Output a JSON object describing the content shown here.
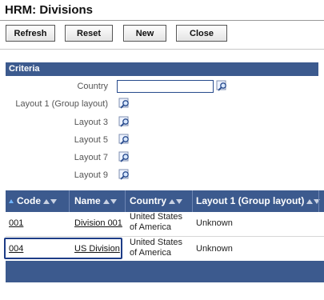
{
  "header": {
    "title": "HRM: Divisions"
  },
  "toolbar": {
    "refresh_label": "Refresh",
    "reset_label": "Reset",
    "new_label": "New",
    "close_label": "Close"
  },
  "criteria": {
    "title": "Criteria",
    "fields": [
      {
        "label": "Country",
        "value": "",
        "type": "text-input"
      },
      {
        "label": "Layout 1 (Group layout)",
        "type": "lookup"
      },
      {
        "label": "Layout 3",
        "type": "lookup"
      },
      {
        "label": "Layout 5",
        "type": "lookup"
      },
      {
        "label": "Layout 7",
        "type": "lookup"
      },
      {
        "label": "Layout 9",
        "type": "lookup"
      }
    ],
    "lookup_icon": "magnifier-lookup-icon"
  },
  "grid": {
    "columns": [
      {
        "label": "Code"
      },
      {
        "label": "Name"
      },
      {
        "label": "Country"
      },
      {
        "label": "Layout 1 (Group layout)"
      }
    ],
    "rows": [
      {
        "code": "001",
        "name": "Division 001",
        "country_line1": "United States",
        "country_line2": "of America",
        "layout1": "Unknown"
      },
      {
        "code": "004",
        "name": "US Division",
        "country_line1": "United States",
        "country_line2": "of America",
        "layout1": "Unknown",
        "selected": true
      }
    ]
  },
  "colors": {
    "header_blue": "#3c5a8e",
    "accent": "#274a8c"
  }
}
